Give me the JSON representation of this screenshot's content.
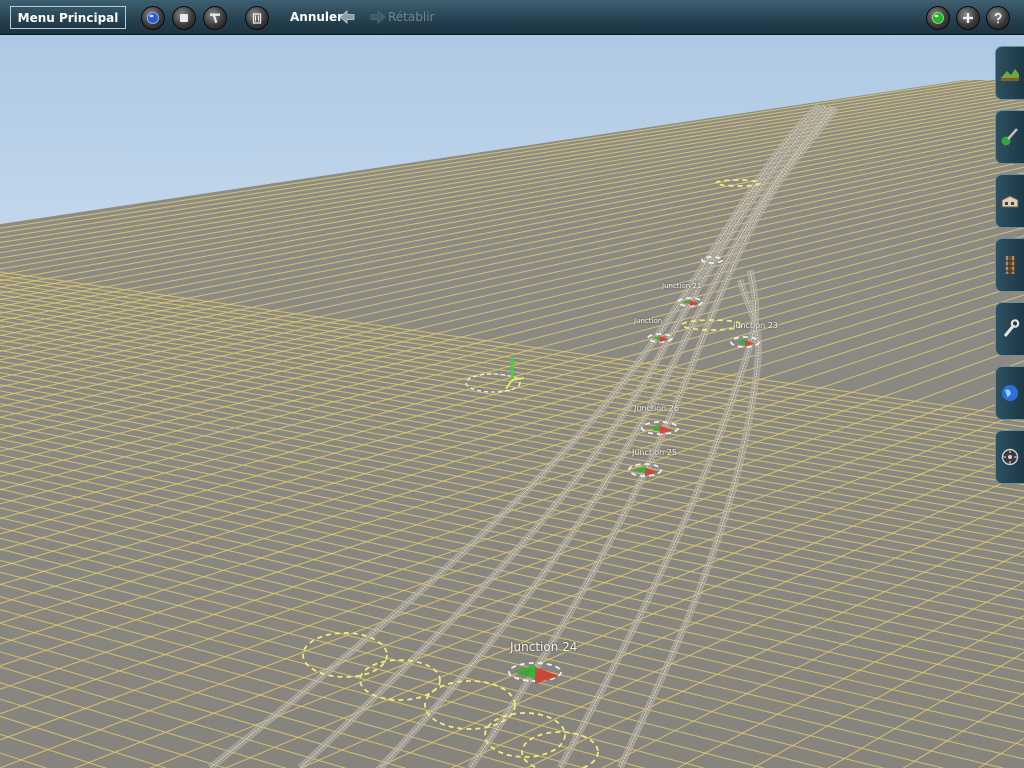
{
  "toolbar": {
    "menu_label": "Menu Principal",
    "undo_label": "Annuler",
    "redo_label": "Rétablir"
  },
  "viewport": {
    "junctions": [
      {
        "label": "Junction 24",
        "size": "large"
      },
      {
        "label": "Junction 25",
        "size": "small"
      },
      {
        "label": "Junction 26",
        "size": "small"
      },
      {
        "label": "Junction 23",
        "size": "small"
      },
      {
        "label": "Junction",
        "size": "small"
      },
      {
        "label": "Junction 21",
        "size": "small"
      }
    ]
  },
  "colors": {
    "sky": "#b3cde6",
    "ground": "#8a8984",
    "grid": "#e8d373",
    "toolbar": "#2a4656",
    "accent_green": "#2fae2f"
  },
  "icons": {
    "top": [
      "globe-icon",
      "stop-icon",
      "tools-icon",
      "trash-icon",
      "undo-arrow-icon",
      "redo-arrow-icon",
      "green-orb-icon",
      "add-icon",
      "help-icon"
    ],
    "side": [
      "terrain-icon",
      "paint-icon",
      "buildings-icon",
      "track-icon",
      "wrench-icon",
      "world-icon",
      "settings-icon"
    ]
  }
}
